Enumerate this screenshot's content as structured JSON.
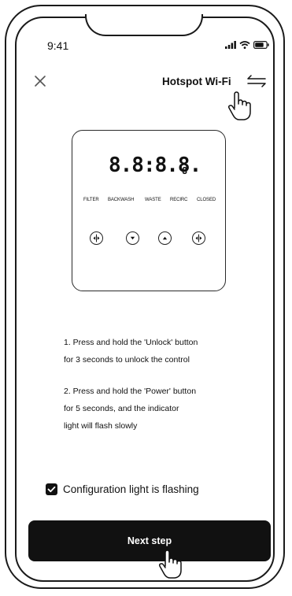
{
  "status_bar": {
    "time": "9:41"
  },
  "header": {
    "title": "Hotspot Wi-Fi"
  },
  "icons": {
    "close": "close-icon",
    "switch": "switch-arrows-icon",
    "pointer": "hand-pointer-icon",
    "signal": "signal-icon",
    "wifi": "wifi-icon",
    "battery": "battery-icon"
  },
  "panel": {
    "display_main": "8.8:8.8.",
    "display_small": "8",
    "indicators": [
      "FILTER",
      "BACKWASH",
      "WASTE",
      "RECIRC",
      "CLOSED"
    ]
  },
  "instructions": {
    "step1_line1": "1. Press and hold the 'Unlock' button",
    "step1_line2": "for 3 seconds to unlock the control",
    "step2_line1": "2. Press and hold the 'Power' button",
    "step2_line2": "for 5 seconds, and the indicator",
    "step2_line3": "light will flash slowly"
  },
  "confirm": {
    "checked": true,
    "label": "Configuration light is flashing"
  },
  "next_button": {
    "label": "Next step"
  },
  "colors": {
    "button_bg": "#111111",
    "button_text": "#ffffff"
  }
}
